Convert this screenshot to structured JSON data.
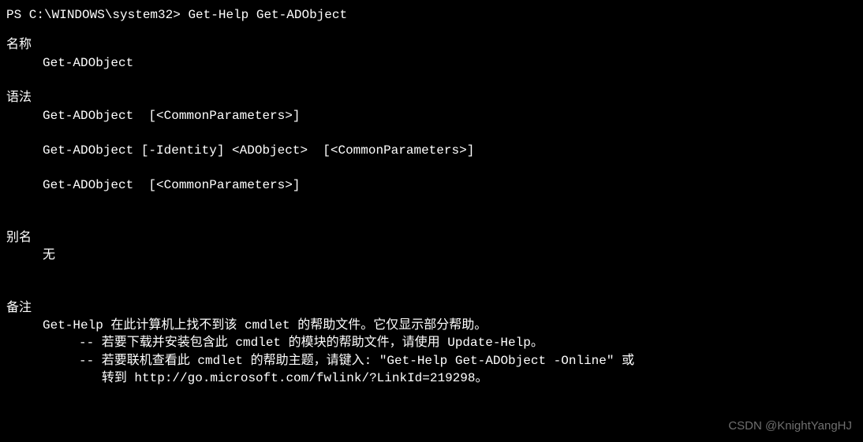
{
  "prompt": {
    "prefix": "PS C:\\WINDOWS\\system32> ",
    "command": "Get-Help Get-ADObject"
  },
  "sections": {
    "name": {
      "header": "名称",
      "value": "Get-ADObject"
    },
    "syntax": {
      "header": "语法",
      "lines": [
        "Get-ADObject  [<CommonParameters>]",
        "Get-ADObject [-Identity] <ADObject>  [<CommonParameters>]",
        "Get-ADObject  [<CommonParameters>]"
      ]
    },
    "alias": {
      "header": "别名",
      "value": "无"
    },
    "remarks": {
      "header": "备注",
      "line1": "Get-Help 在此计算机上找不到该 cmdlet 的帮助文件。它仅显示部分帮助。",
      "line2": "-- 若要下载并安装包含此 cmdlet 的模块的帮助文件，请使用 Update-Help。",
      "line3": "-- 若要联机查看此 cmdlet 的帮助主题，请键入: \"Get-Help Get-ADObject -Online\" 或",
      "line4": "   转到 http://go.microsoft.com/fwlink/?LinkId=219298。"
    }
  },
  "watermark": "CSDN @KnightYangHJ"
}
